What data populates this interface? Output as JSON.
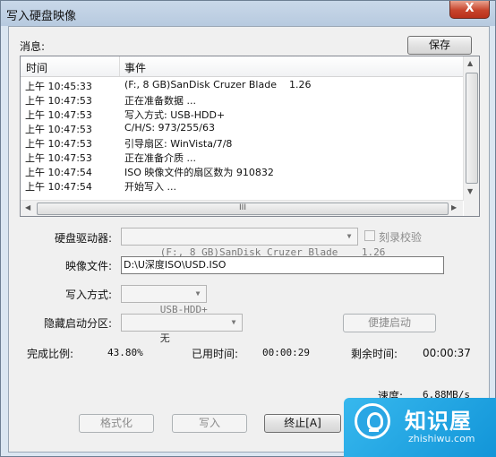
{
  "window": {
    "title": "写入硬盘映像",
    "close_label": "X"
  },
  "messages": {
    "label": "消息:",
    "save_label": "保存",
    "columns": {
      "time": "时间",
      "event": "事件"
    },
    "rows": [
      {
        "time": "上午 10:45:33",
        "event": "(F:, 8 GB)SanDisk Cruzer Blade    1.26"
      },
      {
        "time": "上午 10:47:53",
        "event": "正在准备数据 ..."
      },
      {
        "time": "上午 10:47:53",
        "event": "写入方式: USB-HDD+"
      },
      {
        "time": "上午 10:47:53",
        "event": "C/H/S: 973/255/63"
      },
      {
        "time": "上午 10:47:53",
        "event": "引导扇区: WinVista/7/8"
      },
      {
        "time": "上午 10:47:53",
        "event": "正在准备介质 ..."
      },
      {
        "time": "上午 10:47:54",
        "event": "ISO 映像文件的扇区数为 910832"
      },
      {
        "time": "上午 10:47:54",
        "event": "开始写入 ..."
      }
    ],
    "hscroll_grip": "III"
  },
  "form": {
    "drive_label": "硬盘驱动器:",
    "drive_value": "(F:, 8 GB)SanDisk Cruzer Blade    1.26",
    "verify_label": "刻录校验",
    "image_label": "映像文件:",
    "image_value": "D:\\U深度ISO\\USD.ISO",
    "write_mode_label": "写入方式:",
    "write_mode_value": "USB-HDD+",
    "hide_partition_label": "隐藏启动分区:",
    "hide_partition_value": "无",
    "quick_boot_label": "便捷启动"
  },
  "progress": {
    "complete_label": "完成比例:",
    "complete_value": "43.80%",
    "elapsed_label": "已用时间:",
    "elapsed_value": "00:00:29",
    "remaining_label": "剩余时间:",
    "remaining_value": "00:00:37",
    "speed_label": "速度:",
    "speed_value": "6.88MB/s"
  },
  "actions": {
    "format_label": "格式化",
    "write_label": "写入",
    "stop_label": "终止[A]"
  },
  "watermark": {
    "title": "知识屋",
    "subtitle": "zhishiwu.com"
  }
}
